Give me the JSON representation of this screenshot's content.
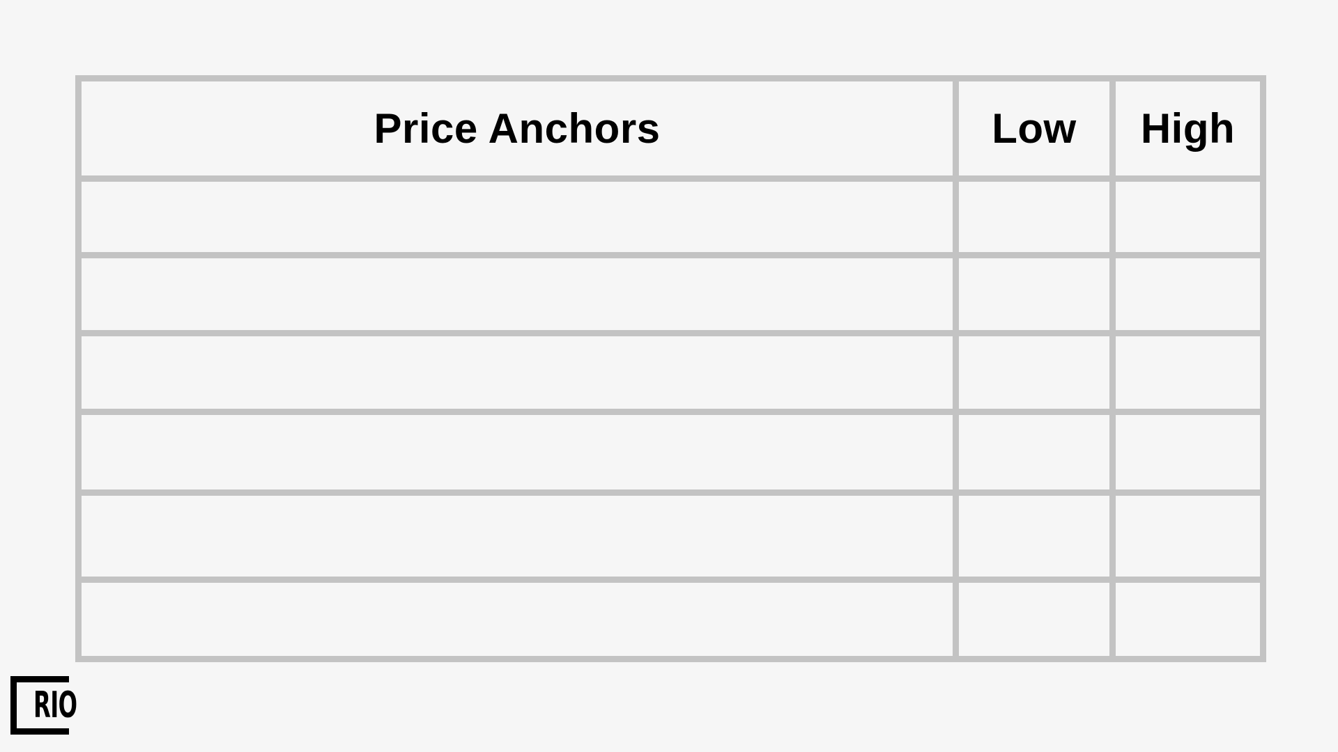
{
  "table": {
    "headers": [
      "Price Anchors",
      "Low",
      "High"
    ],
    "rows": [
      [
        "",
        "",
        ""
      ],
      [
        "",
        "",
        ""
      ],
      [
        "",
        "",
        ""
      ],
      [
        "",
        "",
        ""
      ],
      [
        "",
        "",
        ""
      ],
      [
        "",
        "",
        ""
      ]
    ]
  },
  "logo": {
    "text": "RIO"
  },
  "colors": {
    "background": "#f6f6f6",
    "grid_lines": "#c3c3c3",
    "text": "#000000"
  }
}
